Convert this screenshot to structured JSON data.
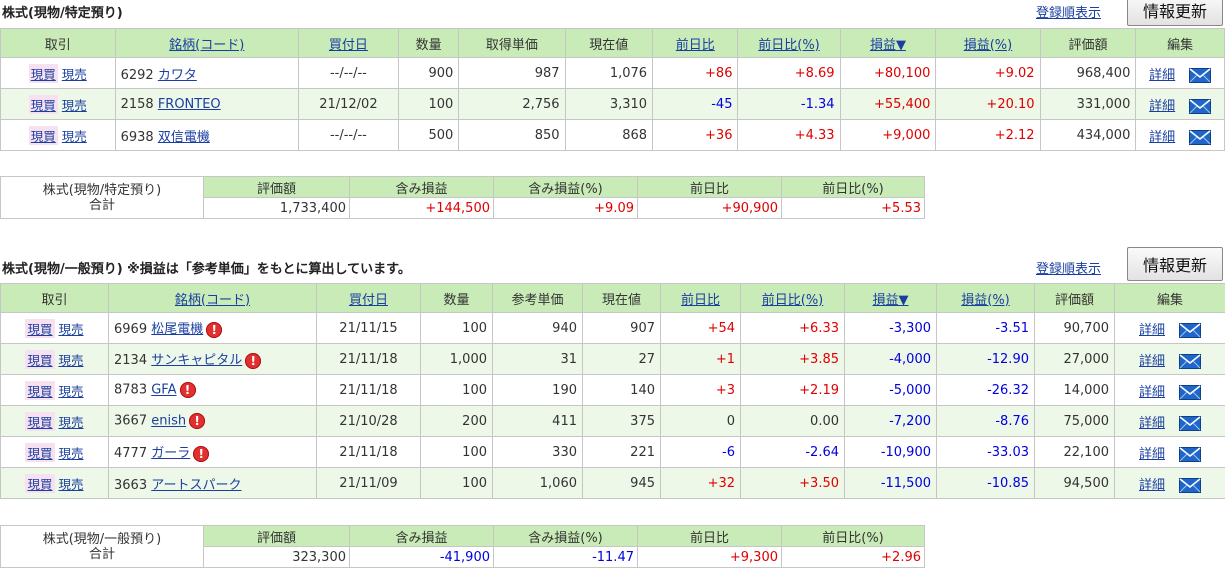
{
  "section1": {
    "title": "株式(現物/特定預り)",
    "sort_link": "登録順表示",
    "refresh": "情報更新",
    "headers": [
      "取引",
      "銘柄(コード)",
      "買付日",
      "数量",
      "取得単価",
      "現在値",
      "前日比",
      "前日比(%)",
      "損益▼",
      "損益(%)",
      "評価額",
      "編集"
    ],
    "rows": [
      {
        "code": "6292",
        "name": "カワタ",
        "date": "--/--/--",
        "qty": "900",
        "cost": "987",
        "price": "1,076",
        "chg": "+86",
        "chgp": "+8.69",
        "pl": "+80,100",
        "plp": "+9.02",
        "value": "968,400"
      },
      {
        "code": "2158",
        "name": "FRONTEO",
        "date": "21/12/02",
        "qty": "100",
        "cost": "2,756",
        "price": "3,310",
        "chg": "-45",
        "chgp": "-1.34",
        "pl": "+55,400",
        "plp": "+20.10",
        "value": "331,000"
      },
      {
        "code": "6938",
        "name": "双信電機",
        "date": "--/--/--",
        "qty": "500",
        "cost": "850",
        "price": "868",
        "chg": "+36",
        "chgp": "+4.33",
        "pl": "+9,000",
        "plp": "+2.12",
        "value": "434,000"
      }
    ],
    "summary": {
      "label1": "株式(現物/特定預り)",
      "label2": "合計",
      "headers": [
        "評価額",
        "含み損益",
        "含み損益(%)",
        "前日比",
        "前日比(%)"
      ],
      "values": [
        "1,733,400",
        "+144,500",
        "+9.09",
        "+90,900",
        "+5.53"
      ]
    }
  },
  "section2": {
    "title": "株式(現物/一般預り) ※損益は「参考単価」をもとに算出しています。",
    "sort_link": "登録順表示",
    "refresh": "情報更新",
    "headers": [
      "取引",
      "銘柄(コード)",
      "買付日",
      "数量",
      "参考単価",
      "現在値",
      "前日比",
      "前日比(%)",
      "損益▼",
      "損益(%)",
      "評価額",
      "編集"
    ],
    "rows": [
      {
        "code": "6969",
        "name": "松尾電機",
        "warn": "!",
        "date": "21/11/15",
        "qty": "100",
        "cost": "940",
        "price": "907",
        "chg": "+54",
        "chgp": "+6.33",
        "pl": "-3,300",
        "plp": "-3.51",
        "value": "90,700"
      },
      {
        "code": "2134",
        "name": "サンキャピタル",
        "warn": "!",
        "date": "21/11/18",
        "qty": "1,000",
        "cost": "31",
        "price": "27",
        "chg": "+1",
        "chgp": "+3.85",
        "pl": "-4,000",
        "plp": "-12.90",
        "value": "27,000"
      },
      {
        "code": "8783",
        "name": "GFA",
        "warn": "!",
        "date": "21/11/18",
        "qty": "100",
        "cost": "190",
        "price": "140",
        "chg": "+3",
        "chgp": "+2.19",
        "pl": "-5,000",
        "plp": "-26.32",
        "value": "14,000"
      },
      {
        "code": "3667",
        "name": "enish",
        "warn": "!",
        "date": "21/10/28",
        "qty": "200",
        "cost": "411",
        "price": "375",
        "chg": "0",
        "chgp": "0.00",
        "pl": "-7,200",
        "plp": "-8.76",
        "value": "75,000"
      },
      {
        "code": "4777",
        "name": "ガーラ",
        "warn": "!",
        "date": "21/11/18",
        "qty": "100",
        "cost": "330",
        "price": "221",
        "chg": "-6",
        "chgp": "-2.64",
        "pl": "-10,900",
        "plp": "-33.03",
        "value": "22,100"
      },
      {
        "code": "3663",
        "name": "アートスパーク",
        "date": "21/11/09",
        "qty": "100",
        "cost": "1,060",
        "price": "945",
        "chg": "+32",
        "chgp": "+3.50",
        "pl": "-11,500",
        "plp": "-10.85",
        "value": "94,500"
      }
    ],
    "summary": {
      "label1": "株式(現物/一般預り)",
      "label2": "合計",
      "headers": [
        "評価額",
        "含み損益",
        "含み損益(%)",
        "前日比",
        "前日比(%)"
      ],
      "values": [
        "323,300",
        "-41,900",
        "-11.47",
        "+9,300",
        "+2.96"
      ]
    }
  },
  "actions": {
    "buy": "現買",
    "sell": "現売",
    "detail": "詳細"
  },
  "colors": {
    "header_bg": "#c8ebb7",
    "positive": "#e00000",
    "negative": "#0000e0",
    "link": "#1a3fa0"
  },
  "icons": {
    "mail": "mail-icon",
    "warning": "warning-icon"
  }
}
